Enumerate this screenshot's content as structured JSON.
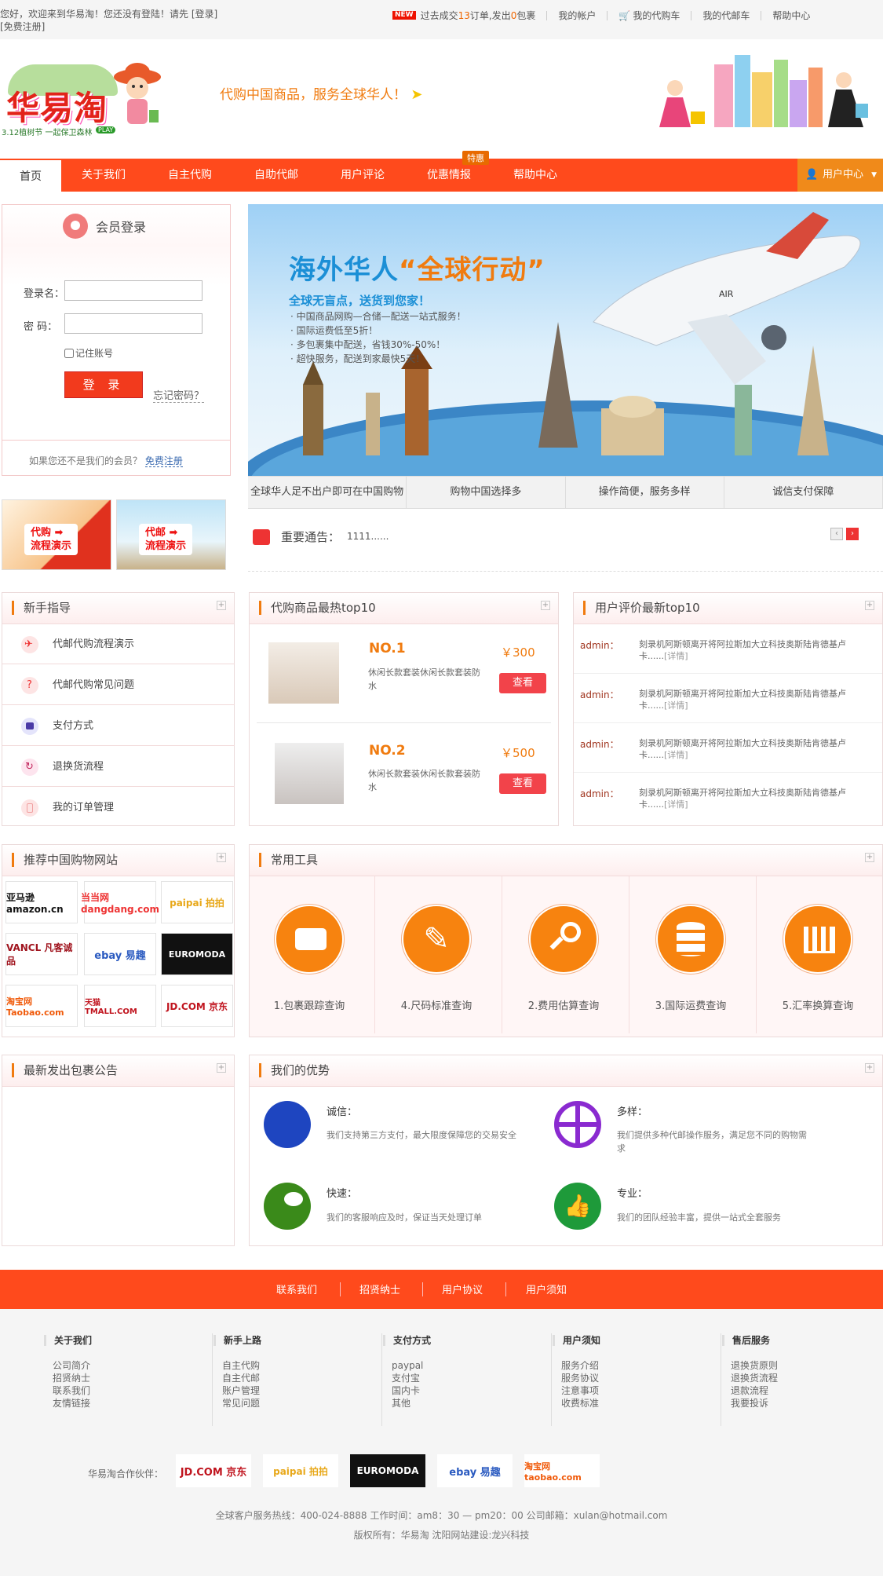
{
  "topbar": {
    "welcome_line1": "您好，欢迎来到华易淘！您还没有登陆！请先 [登录]",
    "welcome_line2": "[免费注册]",
    "new_badge": "NEW",
    "stats_prefix": "过去成交",
    "stats_orders": "13",
    "stats_mid": "订单,发出",
    "stats_packages": "0",
    "stats_suffix": "包裹",
    "my_account": "我的帐户",
    "my_cart": "我的代购车",
    "my_ship_cart": "我的代邮车",
    "help_center": "帮助中心"
  },
  "header": {
    "logo_text": "华易淘",
    "logo_sub": "3.12植树节  一起保卫森林",
    "logo_play": "PLAY",
    "slogan": "代购中国商品，服务全球华人！"
  },
  "nav": {
    "items": [
      "首页",
      "关于我们",
      "自主代购",
      "自助代邮",
      "用户评论",
      "优惠情报",
      "帮助中心"
    ],
    "badge": "特惠",
    "user_center": "用户中心"
  },
  "login": {
    "title": "会员登录",
    "username_label": "登录名：",
    "password_label": "密  码：",
    "remember": "记住账号",
    "submit": "登  录",
    "forgot": "忘记密码？",
    "reg_prefix": "如果您还不是我们的会员？",
    "reg_link": "免费注册"
  },
  "demos": [
    {
      "line1": "代购 ➡",
      "line2": "流程演示"
    },
    {
      "line1": "代邮 ➡",
      "line2": "流程演示"
    }
  ],
  "banner": {
    "title_a": "海外华人",
    "title_b": "“全球行动”",
    "subtitle": "全球无盲点，送货到您家！",
    "bullets": [
      "· 中国商品网购—合储—配送一站式服务！",
      "· 国际运费低至5折！",
      "· 多包裹集中配送，省钱30%-50%！",
      "· 超快服务，配送到家最快5天！"
    ],
    "plane_text": "AIR",
    "tabs": [
      "全球华人足不出户即可在中国购物",
      "购物中国选择多",
      "操作简便，服务多样",
      "诚信支付保障"
    ]
  },
  "notice": {
    "label": "重要通告：",
    "text": "1111......",
    "prev": "‹",
    "next": "›"
  },
  "guide": {
    "title": "新手指导",
    "toggle": "+",
    "items": [
      "代邮代购流程演示",
      "代邮代购常见问题",
      "支付方式",
      "退换货流程",
      "我的订单管理"
    ]
  },
  "top10": {
    "title": "代购商品最热top10",
    "toggle": "+",
    "items": [
      {
        "rank": "NO.1",
        "desc": "休闲长款套装休闲长款套装防水",
        "price": "￥300",
        "btn": "查看"
      },
      {
        "rank": "NO.2",
        "desc": "休闲长款套装休闲长款套装防水",
        "price": "￥500",
        "btn": "查看"
      }
    ]
  },
  "reviews": {
    "title": "用户评价最新top10",
    "toggle": "+",
    "items": [
      {
        "user": "admin：",
        "text": "刻录机阿斯顿离开将阿拉斯加大立科技奥斯陆肯德基卢卡......",
        "more": "[详情]"
      },
      {
        "user": "admin：",
        "text": "刻录机阿斯顿离开将阿拉斯加大立科技奥斯陆肯德基卢卡......",
        "more": "[详情]"
      },
      {
        "user": "admin：",
        "text": "刻录机阿斯顿离开将阿拉斯加大立科技奥斯陆肯德基卢卡......",
        "more": "[详情]"
      },
      {
        "user": "admin：",
        "text": "刻录机阿斯顿离开将阿拉斯加大立科技奥斯陆肯德基卢卡......",
        "more": "[详情]"
      }
    ]
  },
  "shops": {
    "title": "推荐中国购物网站",
    "toggle": "+",
    "items": [
      "亚马逊 amazon.cn",
      "当当网 dangdang.com",
      "paipai 拍拍",
      "VANCL 凡客诚品",
      "ebay 易趣",
      "EUROMODA",
      "淘宝网 Taobao.com",
      "天猫 TMALL.COM",
      "JD.COM 京东"
    ]
  },
  "tools": {
    "title": "常用工具",
    "toggle": "+",
    "items": [
      "1.包裹跟踪查询",
      "4.尺码标准查询",
      "2.费用估算查询",
      "3.国际运费查询",
      "5.汇率换算查询"
    ]
  },
  "packages": {
    "title": "最新发出包裹公告",
    "toggle": "+"
  },
  "advantages": {
    "title": "我们的优势",
    "toggle": "+",
    "items": [
      {
        "title": "诚信：",
        "desc": "我们支持第三方支付，最大限度保障您的交易安全"
      },
      {
        "title": "多样：",
        "desc": "我们提供多种代邮操作服务，满足您不同的购物需求"
      },
      {
        "title": "快速：",
        "desc": "我们的客服响应及时，保证当天处理订单"
      },
      {
        "title": "专业：",
        "desc": "我们的团队经验丰富，提供一站式全套服务"
      }
    ]
  },
  "footer": {
    "links": [
      "联系我们",
      "招贤纳士",
      "用户协议",
      "用户须知"
    ],
    "columns": [
      {
        "title": "关于我们",
        "items": [
          "公司简介",
          "招贤纳士",
          "联系我们",
          "友情链接"
        ]
      },
      {
        "title": "新手上路",
        "items": [
          "自主代购",
          "自主代邮",
          "账户管理",
          "常见问题"
        ]
      },
      {
        "title": "支付方式",
        "items": [
          "paypal",
          "支付宝",
          "国内卡",
          "其他"
        ]
      },
      {
        "title": "用户须知",
        "items": [
          "服务介绍",
          "服务协议",
          "注意事项",
          "收费标准"
        ]
      },
      {
        "title": "售后服务",
        "items": [
          "退换货原则",
          "退换货流程",
          "退款流程",
          "我要投诉"
        ]
      }
    ],
    "partner_label": "华易淘合作伙伴：",
    "partners": [
      "JD.COM 京东",
      "paipai 拍拍",
      "EUROMODA",
      "ebay 易趣",
      "淘宝网 taobao.com"
    ],
    "hotline": "全球客户服务热线：400-024-8888 工作时间：am8：30 — pm20：00 公司邮箱：xulan@hotmail.com",
    "copyright": "版权所有：华易淘 沈阳网站建设:龙兴科技"
  },
  "colors": {
    "brand": "#ff4a1c",
    "accent": "#f07b0f",
    "tool_circle": "#f7830f"
  }
}
